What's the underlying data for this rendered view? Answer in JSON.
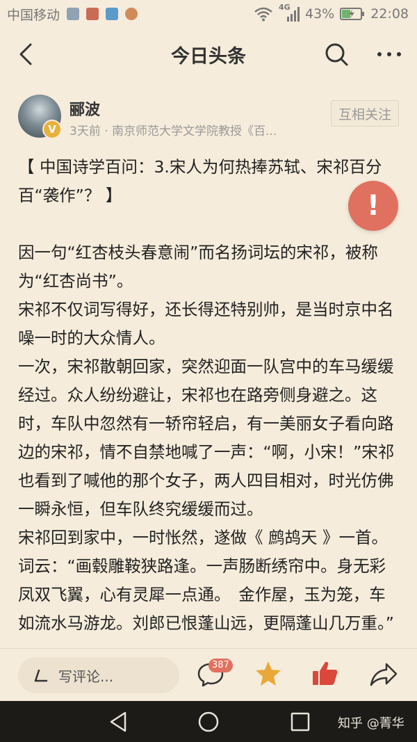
{
  "status_bar": {
    "carrier": "中国移动",
    "network": "4G",
    "battery": "43%",
    "time": "22:08"
  },
  "nav": {
    "title": "今日头条"
  },
  "author": {
    "name": "郦波",
    "meta": "3天前 · 南京师范大学文学院教授《百...",
    "follow_label": "互相关注",
    "badge": "V"
  },
  "article": {
    "title": "【 中国诗学百问：3.宋人为何热捧苏轼、宋祁百分百“袭作”？ 】",
    "paragraphs": [
      "因一句“红杏枝头春意闹”而名扬词坛的宋祁，被称为“红杏尚书”。",
      "宋祁不仅词写得好，还长得还特别帅，是当时京中名噪一时的大众情人。",
      "一次，宋祁散朝回家，突然迎面一队宫中的车马缓缓经过。众人纷纷避让，宋祁也在路旁侧身避之。这时，车队中忽然有一轿帘轻启，有一美丽女子看向路边的宋祁，情不自禁地喊了一声：“啊，小宋！”宋祁也看到了喊他的那个女子，两人四目相对，时光仿佛一瞬永恒，但车队终究缓缓而过。",
      "宋祁回到家中，一时怅然，遂做《 鹧鸪天 》一首。词云：“画毂雕鞍狭路逢。一声肠断绣帘中。身无彩凤双飞翼，心有灵犀一点通。　金作屋，玉为笼，车如流水马游龙。刘郎已恨蓬山远，更隔蓬山几万重。”"
    ],
    "report_label": "!"
  },
  "bottom_bar": {
    "comment_placeholder": "写评论...",
    "comment_count": "387"
  },
  "system_nav": {
    "watermark": "知乎 @菁华"
  },
  "colors": {
    "background": "#f6ecdb",
    "accent_red": "#e0705f",
    "star_yellow": "#e9a83a",
    "like_red": "#d9483a"
  }
}
